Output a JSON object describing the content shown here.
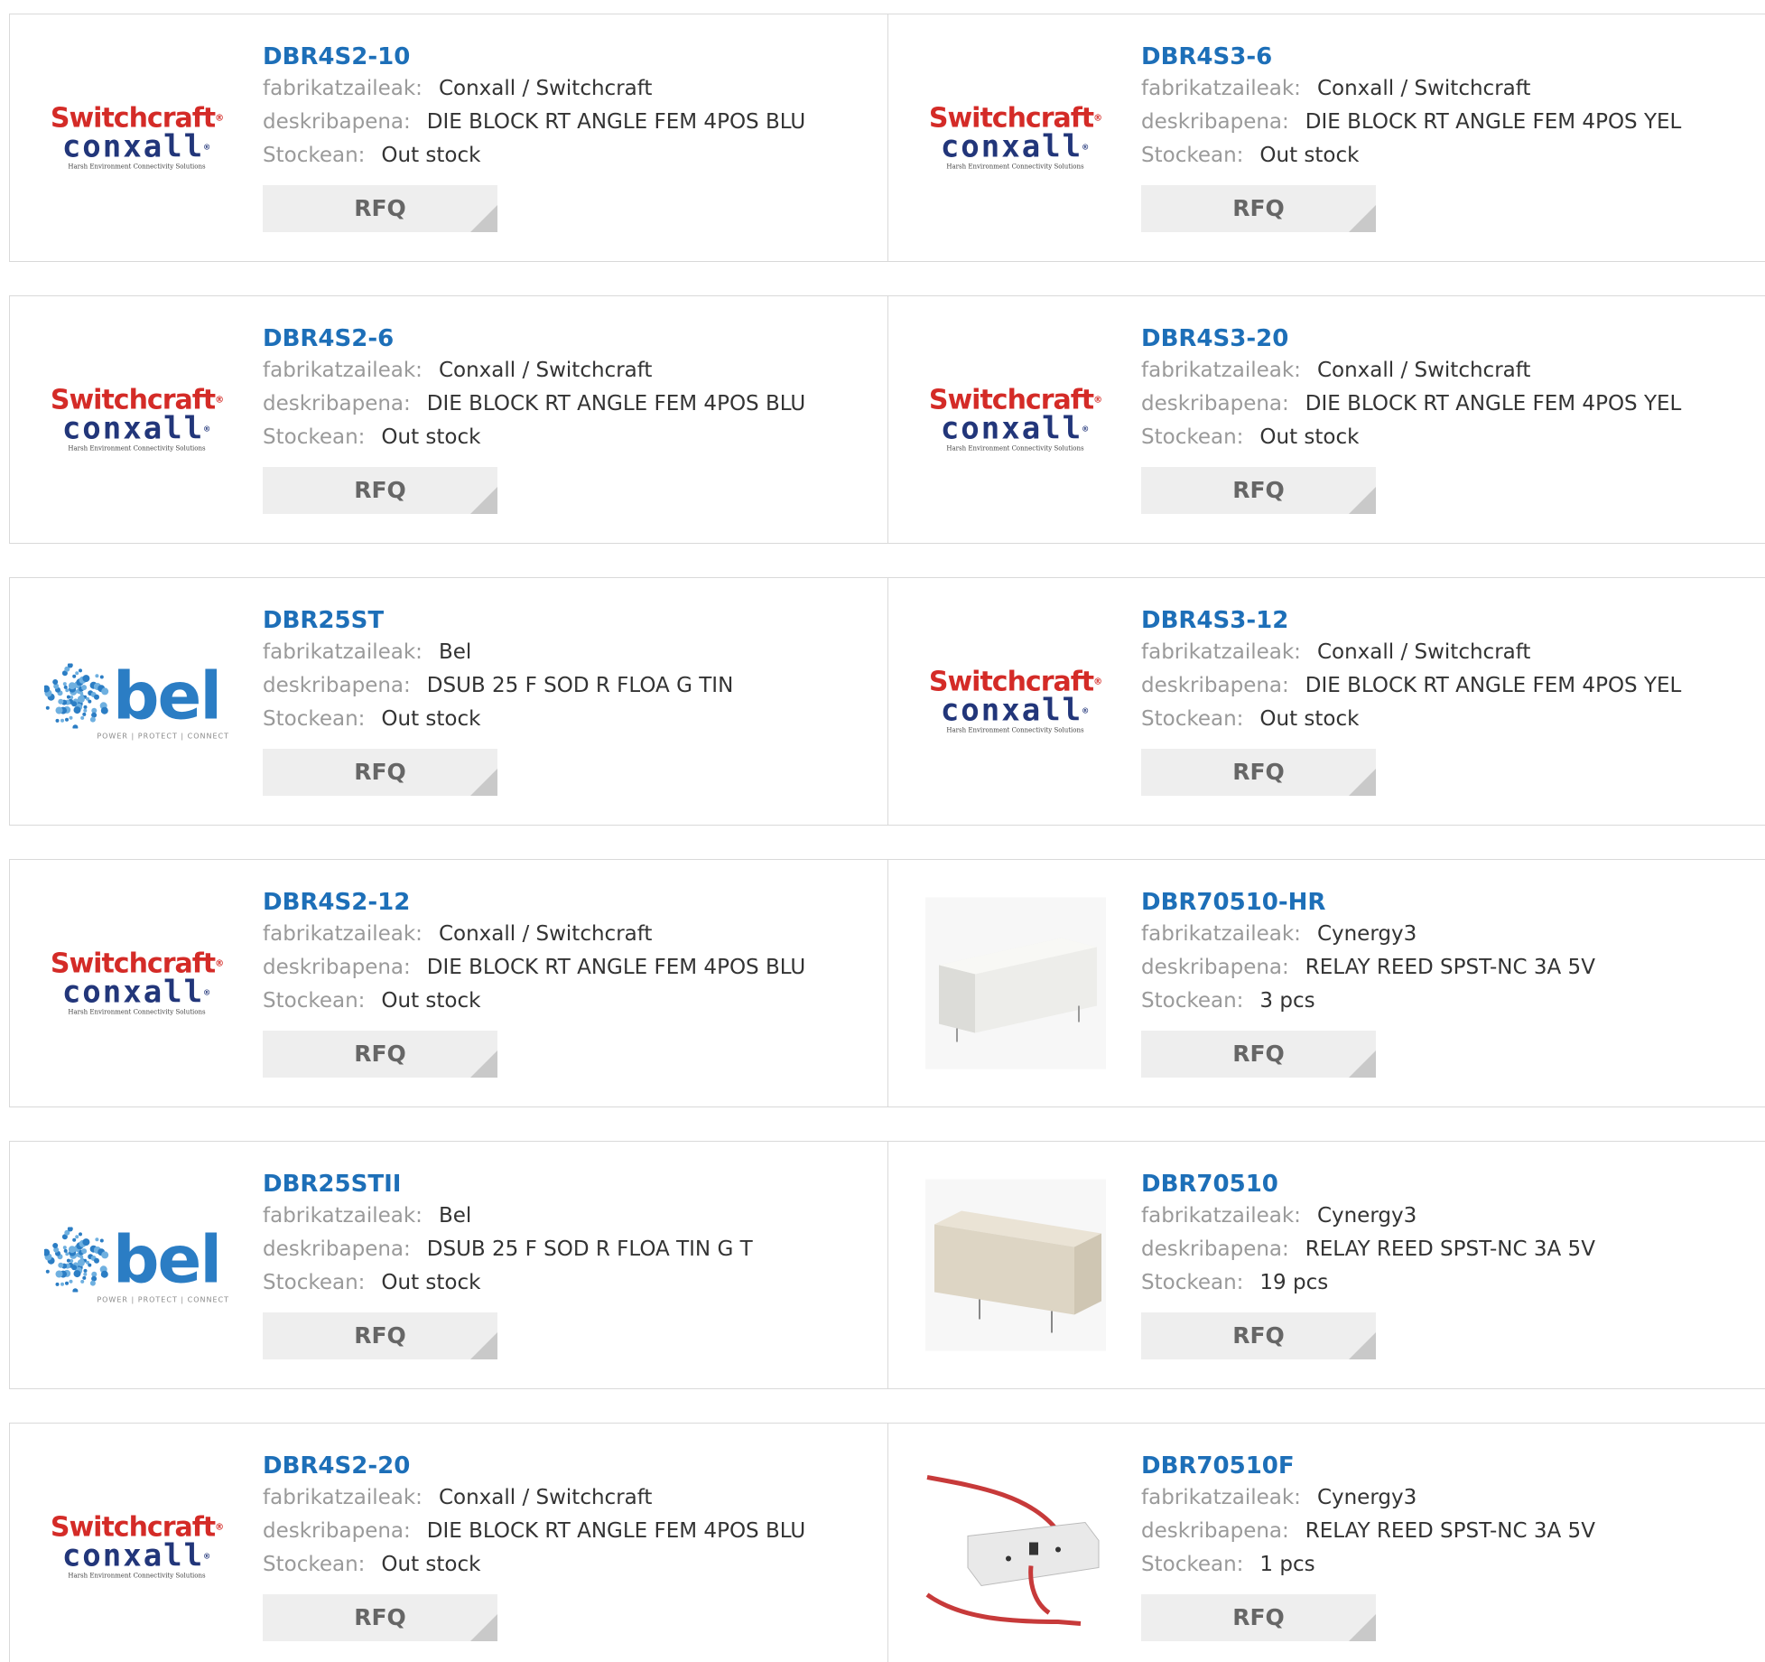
{
  "labels": {
    "manufacturer": "fabrikatzaileak:",
    "description": "deskribapena:",
    "stock": "Stockean:",
    "rfq": "RFQ"
  },
  "logos": {
    "switchcraft": {
      "brand": "Switchcraft",
      "sub": "conxall",
      "tagline": "Harsh Environment Connectivity Solutions"
    },
    "bel": {
      "brand": "bel",
      "tagline": "POWER | PROTECT | CONNECT"
    }
  },
  "colors": {
    "link": "#1d6fb8",
    "label": "#9a9a9a",
    "value": "#333333",
    "button_bg": "#eeeeee",
    "border": "#d9d9d9"
  },
  "products": [
    {
      "pn": "DBR4S2-10",
      "mfr": "Conxall / Switchcraft",
      "desc": "DIE BLOCK RT ANGLE FEM 4POS BLU",
      "stock": "Out stock",
      "image": "switchcraft"
    },
    {
      "pn": "DBR4S3-6",
      "mfr": "Conxall / Switchcraft",
      "desc": "DIE BLOCK RT ANGLE FEM 4POS YEL",
      "stock": "Out stock",
      "image": "switchcraft"
    },
    {
      "pn": "DBR4S2-6",
      "mfr": "Conxall / Switchcraft",
      "desc": "DIE BLOCK RT ANGLE FEM 4POS BLU",
      "stock": "Out stock",
      "image": "switchcraft"
    },
    {
      "pn": "DBR4S3-20",
      "mfr": "Conxall / Switchcraft",
      "desc": "DIE BLOCK RT ANGLE FEM 4POS YEL",
      "stock": "Out stock",
      "image": "switchcraft"
    },
    {
      "pn": "DBR25ST",
      "mfr": "Bel",
      "desc": "DSUB 25 F SOD R FLOA G TIN",
      "stock": "Out stock",
      "image": "bel"
    },
    {
      "pn": "DBR4S3-12",
      "mfr": "Conxall / Switchcraft",
      "desc": "DIE BLOCK RT ANGLE FEM 4POS YEL",
      "stock": "Out stock",
      "image": "switchcraft"
    },
    {
      "pn": "DBR4S2-12",
      "mfr": "Conxall / Switchcraft",
      "desc": "DIE BLOCK RT ANGLE FEM 4POS BLU",
      "stock": "Out stock",
      "image": "switchcraft"
    },
    {
      "pn": "DBR70510-HR",
      "mfr": "Cynergy3",
      "desc": "RELAY REED SPST-NC 3A 5V",
      "stock": "3 pcs",
      "image": "relay-light"
    },
    {
      "pn": "DBR25STII",
      "mfr": "Bel",
      "desc": "DSUB 25 F SOD R FLOA TIN G T",
      "stock": "Out stock",
      "image": "bel"
    },
    {
      "pn": "DBR70510",
      "mfr": "Cynergy3",
      "desc": "RELAY REED SPST-NC 3A 5V",
      "stock": "19 pcs",
      "image": "relay-beige"
    },
    {
      "pn": "DBR4S2-20",
      "mfr": "Conxall / Switchcraft",
      "desc": "DIE BLOCK RT ANGLE FEM 4POS BLU",
      "stock": "Out stock",
      "image": "switchcraft"
    },
    {
      "pn": "DBR70510F",
      "mfr": "Cynergy3",
      "desc": "RELAY REED SPST-NC 3A 5V",
      "stock": "1 pcs",
      "image": "relay-wired"
    }
  ]
}
